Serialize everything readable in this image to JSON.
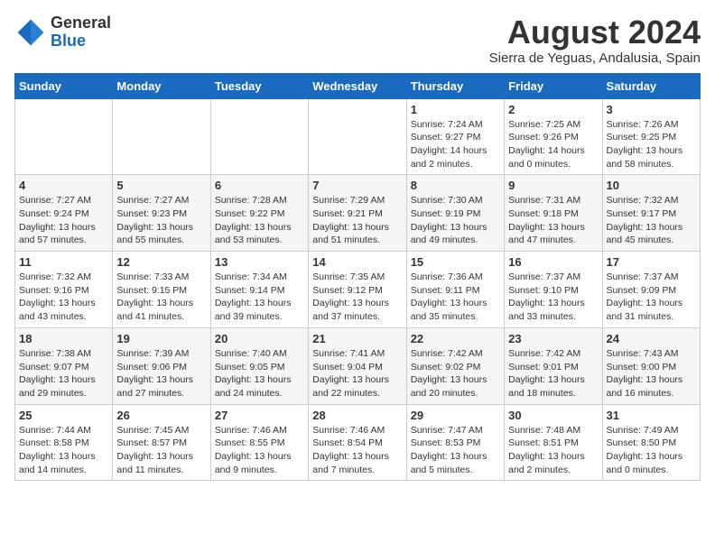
{
  "header": {
    "logo_general": "General",
    "logo_blue": "Blue",
    "month_title": "August 2024",
    "location": "Sierra de Yeguas, Andalusia, Spain"
  },
  "days_of_week": [
    "Sunday",
    "Monday",
    "Tuesday",
    "Wednesday",
    "Thursday",
    "Friday",
    "Saturday"
  ],
  "weeks": [
    [
      {
        "day": "",
        "info": ""
      },
      {
        "day": "",
        "info": ""
      },
      {
        "day": "",
        "info": ""
      },
      {
        "day": "",
        "info": ""
      },
      {
        "day": "1",
        "info": "Sunrise: 7:24 AM\nSunset: 9:27 PM\nDaylight: 14 hours\nand 2 minutes."
      },
      {
        "day": "2",
        "info": "Sunrise: 7:25 AM\nSunset: 9:26 PM\nDaylight: 14 hours\nand 0 minutes."
      },
      {
        "day": "3",
        "info": "Sunrise: 7:26 AM\nSunset: 9:25 PM\nDaylight: 13 hours\nand 58 minutes."
      }
    ],
    [
      {
        "day": "4",
        "info": "Sunrise: 7:27 AM\nSunset: 9:24 PM\nDaylight: 13 hours\nand 57 minutes."
      },
      {
        "day": "5",
        "info": "Sunrise: 7:27 AM\nSunset: 9:23 PM\nDaylight: 13 hours\nand 55 minutes."
      },
      {
        "day": "6",
        "info": "Sunrise: 7:28 AM\nSunset: 9:22 PM\nDaylight: 13 hours\nand 53 minutes."
      },
      {
        "day": "7",
        "info": "Sunrise: 7:29 AM\nSunset: 9:21 PM\nDaylight: 13 hours\nand 51 minutes."
      },
      {
        "day": "8",
        "info": "Sunrise: 7:30 AM\nSunset: 9:19 PM\nDaylight: 13 hours\nand 49 minutes."
      },
      {
        "day": "9",
        "info": "Sunrise: 7:31 AM\nSunset: 9:18 PM\nDaylight: 13 hours\nand 47 minutes."
      },
      {
        "day": "10",
        "info": "Sunrise: 7:32 AM\nSunset: 9:17 PM\nDaylight: 13 hours\nand 45 minutes."
      }
    ],
    [
      {
        "day": "11",
        "info": "Sunrise: 7:32 AM\nSunset: 9:16 PM\nDaylight: 13 hours\nand 43 minutes."
      },
      {
        "day": "12",
        "info": "Sunrise: 7:33 AM\nSunset: 9:15 PM\nDaylight: 13 hours\nand 41 minutes."
      },
      {
        "day": "13",
        "info": "Sunrise: 7:34 AM\nSunset: 9:14 PM\nDaylight: 13 hours\nand 39 minutes."
      },
      {
        "day": "14",
        "info": "Sunrise: 7:35 AM\nSunset: 9:12 PM\nDaylight: 13 hours\nand 37 minutes."
      },
      {
        "day": "15",
        "info": "Sunrise: 7:36 AM\nSunset: 9:11 PM\nDaylight: 13 hours\nand 35 minutes."
      },
      {
        "day": "16",
        "info": "Sunrise: 7:37 AM\nSunset: 9:10 PM\nDaylight: 13 hours\nand 33 minutes."
      },
      {
        "day": "17",
        "info": "Sunrise: 7:37 AM\nSunset: 9:09 PM\nDaylight: 13 hours\nand 31 minutes."
      }
    ],
    [
      {
        "day": "18",
        "info": "Sunrise: 7:38 AM\nSunset: 9:07 PM\nDaylight: 13 hours\nand 29 minutes."
      },
      {
        "day": "19",
        "info": "Sunrise: 7:39 AM\nSunset: 9:06 PM\nDaylight: 13 hours\nand 27 minutes."
      },
      {
        "day": "20",
        "info": "Sunrise: 7:40 AM\nSunset: 9:05 PM\nDaylight: 13 hours\nand 24 minutes."
      },
      {
        "day": "21",
        "info": "Sunrise: 7:41 AM\nSunset: 9:04 PM\nDaylight: 13 hours\nand 22 minutes."
      },
      {
        "day": "22",
        "info": "Sunrise: 7:42 AM\nSunset: 9:02 PM\nDaylight: 13 hours\nand 20 minutes."
      },
      {
        "day": "23",
        "info": "Sunrise: 7:42 AM\nSunset: 9:01 PM\nDaylight: 13 hours\nand 18 minutes."
      },
      {
        "day": "24",
        "info": "Sunrise: 7:43 AM\nSunset: 9:00 PM\nDaylight: 13 hours\nand 16 minutes."
      }
    ],
    [
      {
        "day": "25",
        "info": "Sunrise: 7:44 AM\nSunset: 8:58 PM\nDaylight: 13 hours\nand 14 minutes."
      },
      {
        "day": "26",
        "info": "Sunrise: 7:45 AM\nSunset: 8:57 PM\nDaylight: 13 hours\nand 11 minutes."
      },
      {
        "day": "27",
        "info": "Sunrise: 7:46 AM\nSunset: 8:55 PM\nDaylight: 13 hours\nand 9 minutes."
      },
      {
        "day": "28",
        "info": "Sunrise: 7:46 AM\nSunset: 8:54 PM\nDaylight: 13 hours\nand 7 minutes."
      },
      {
        "day": "29",
        "info": "Sunrise: 7:47 AM\nSunset: 8:53 PM\nDaylight: 13 hours\nand 5 minutes."
      },
      {
        "day": "30",
        "info": "Sunrise: 7:48 AM\nSunset: 8:51 PM\nDaylight: 13 hours\nand 2 minutes."
      },
      {
        "day": "31",
        "info": "Sunrise: 7:49 AM\nSunset: 8:50 PM\nDaylight: 13 hours\nand 0 minutes."
      }
    ]
  ]
}
